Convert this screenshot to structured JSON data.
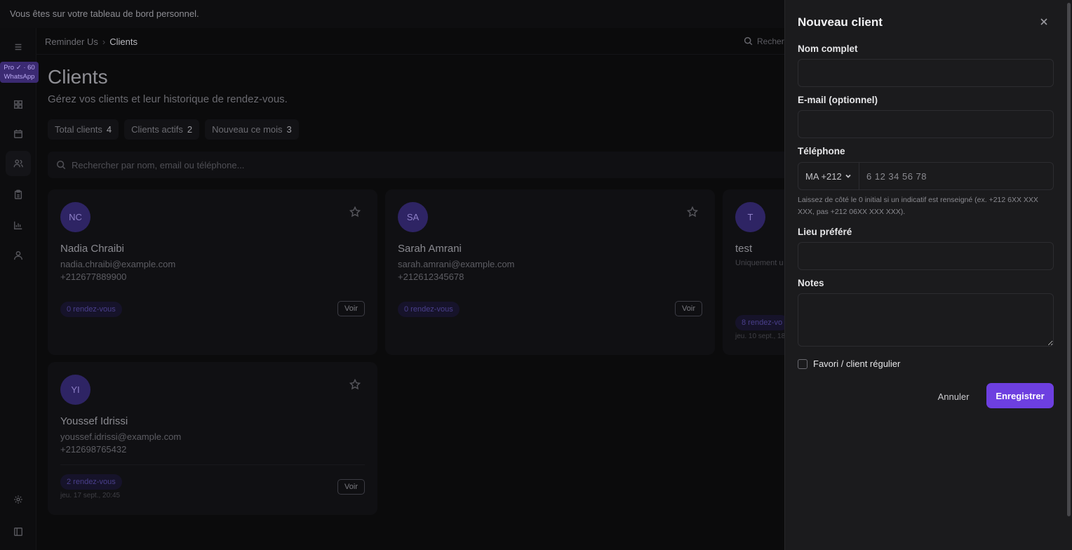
{
  "banner": {
    "text": "Vous êtes sur votre tableau de bord personnel."
  },
  "sidebar": {
    "pro_badge_line1": "Pro ✓ · 60",
    "pro_badge_line2": "WhatsApp",
    "items": [
      "menu",
      "dashboard",
      "calendar",
      "clients",
      "clipboard",
      "stats",
      "team",
      "settings",
      "panel"
    ],
    "active": "clients"
  },
  "breadcrumb": {
    "root": "Reminder Us",
    "separator": "›",
    "current": "Clients"
  },
  "top_search": {
    "placeholder": "Recher"
  },
  "page": {
    "title": "Clients",
    "subtitle": "Gérez vos clients et leur historique de rendez-vous."
  },
  "stats": [
    {
      "label": "Total clients",
      "value": "4"
    },
    {
      "label": "Clients actifs",
      "value": "2"
    },
    {
      "label": "Nouveau ce mois",
      "value": "3"
    }
  ],
  "search": {
    "placeholder": "Rechercher par nom, email ou téléphone..."
  },
  "clients": [
    {
      "initials": "NC",
      "name": "Nadia Chraibi",
      "email": "nadia.chraibi@example.com",
      "phone": "+212677889900",
      "rdv": "0 rendez-vous",
      "last": "",
      "view": "Voir"
    },
    {
      "initials": "SA",
      "name": "Sarah Amrani",
      "email": "sarah.amrani@example.com",
      "phone": "+212612345678",
      "rdv": "0 rendez-vous",
      "last": "",
      "view": "Voir"
    },
    {
      "initials": "T",
      "name": "test",
      "sub": "Uniquement u",
      "rdv": "8 rendez-vo",
      "last": "jeu. 10 sept., 18"
    },
    {
      "initials": "YI",
      "name": "Youssef Idrissi",
      "email": "youssef.idrissi@example.com",
      "phone": "+212698765432",
      "rdv": "2 rendez-vous",
      "last": "jeu. 17 sept., 20:45",
      "view": "Voir"
    }
  ],
  "drawer": {
    "title": "Nouveau client",
    "name_label": "Nom complet",
    "email_label": "E-mail (optionnel)",
    "phone_label": "Téléphone",
    "country_code": "MA +212",
    "phone_placeholder": "6 12 34 56 78",
    "hint": "Laissez de côté le 0 initial si un indicatif est renseigné (ex. +212 6XX XXX XXX, pas +212 06XX XXX XXX).",
    "place_label": "Lieu préféré",
    "notes_label": "Notes",
    "favorite_label": "Favori / client régulier",
    "cancel": "Annuler",
    "save": "Enregistrer"
  },
  "colors": {
    "accent": "#6d3fe0",
    "avatar_bg": "#2e2464",
    "badge_bg": "#3b2a72"
  }
}
